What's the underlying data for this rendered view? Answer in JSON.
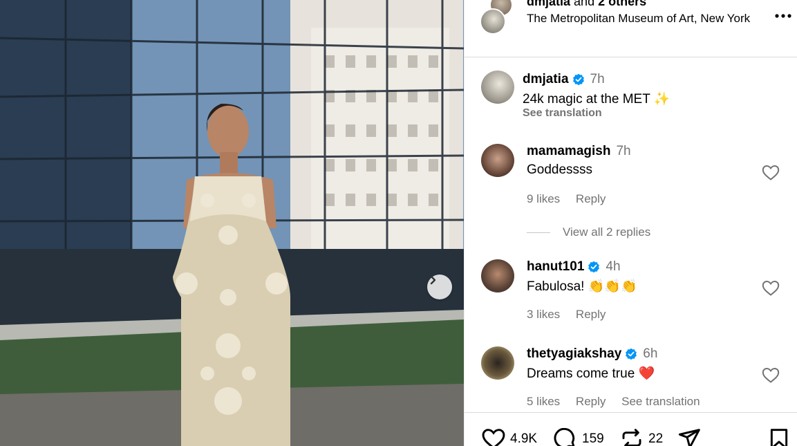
{
  "post": {
    "users_primary": "dmjatia",
    "users_joiner": "and",
    "users_others": "2 others",
    "location": "The Metropolitan Museum of Art, New York",
    "caption": {
      "username": "dmjatia",
      "time": "7h",
      "text": "24k magic at the MET ✨",
      "see_translation": "See translation"
    }
  },
  "comments": [
    {
      "username": "mamamagish",
      "verified": false,
      "time": "7h",
      "text": "Goddessss",
      "likes": "9 likes",
      "reply": "Reply"
    },
    {
      "username": "hanut101",
      "verified": true,
      "time": "4h",
      "text": "Fabulosa! 👏👏👏",
      "likes": "3 likes",
      "reply": "Reply"
    },
    {
      "username": "thetyagiakshay",
      "verified": true,
      "time": "6h",
      "text": "Dreams come true ❤️",
      "likes": "5 likes",
      "reply": "Reply",
      "see_translation": "See translation"
    }
  ],
  "view_replies": "View all 2 replies",
  "actions": {
    "likes": "4.9K",
    "comments": "159",
    "reposts": "22"
  },
  "colors": {
    "verified": "#0095f6",
    "muted": "#737373",
    "border": "#dbdbdb"
  }
}
